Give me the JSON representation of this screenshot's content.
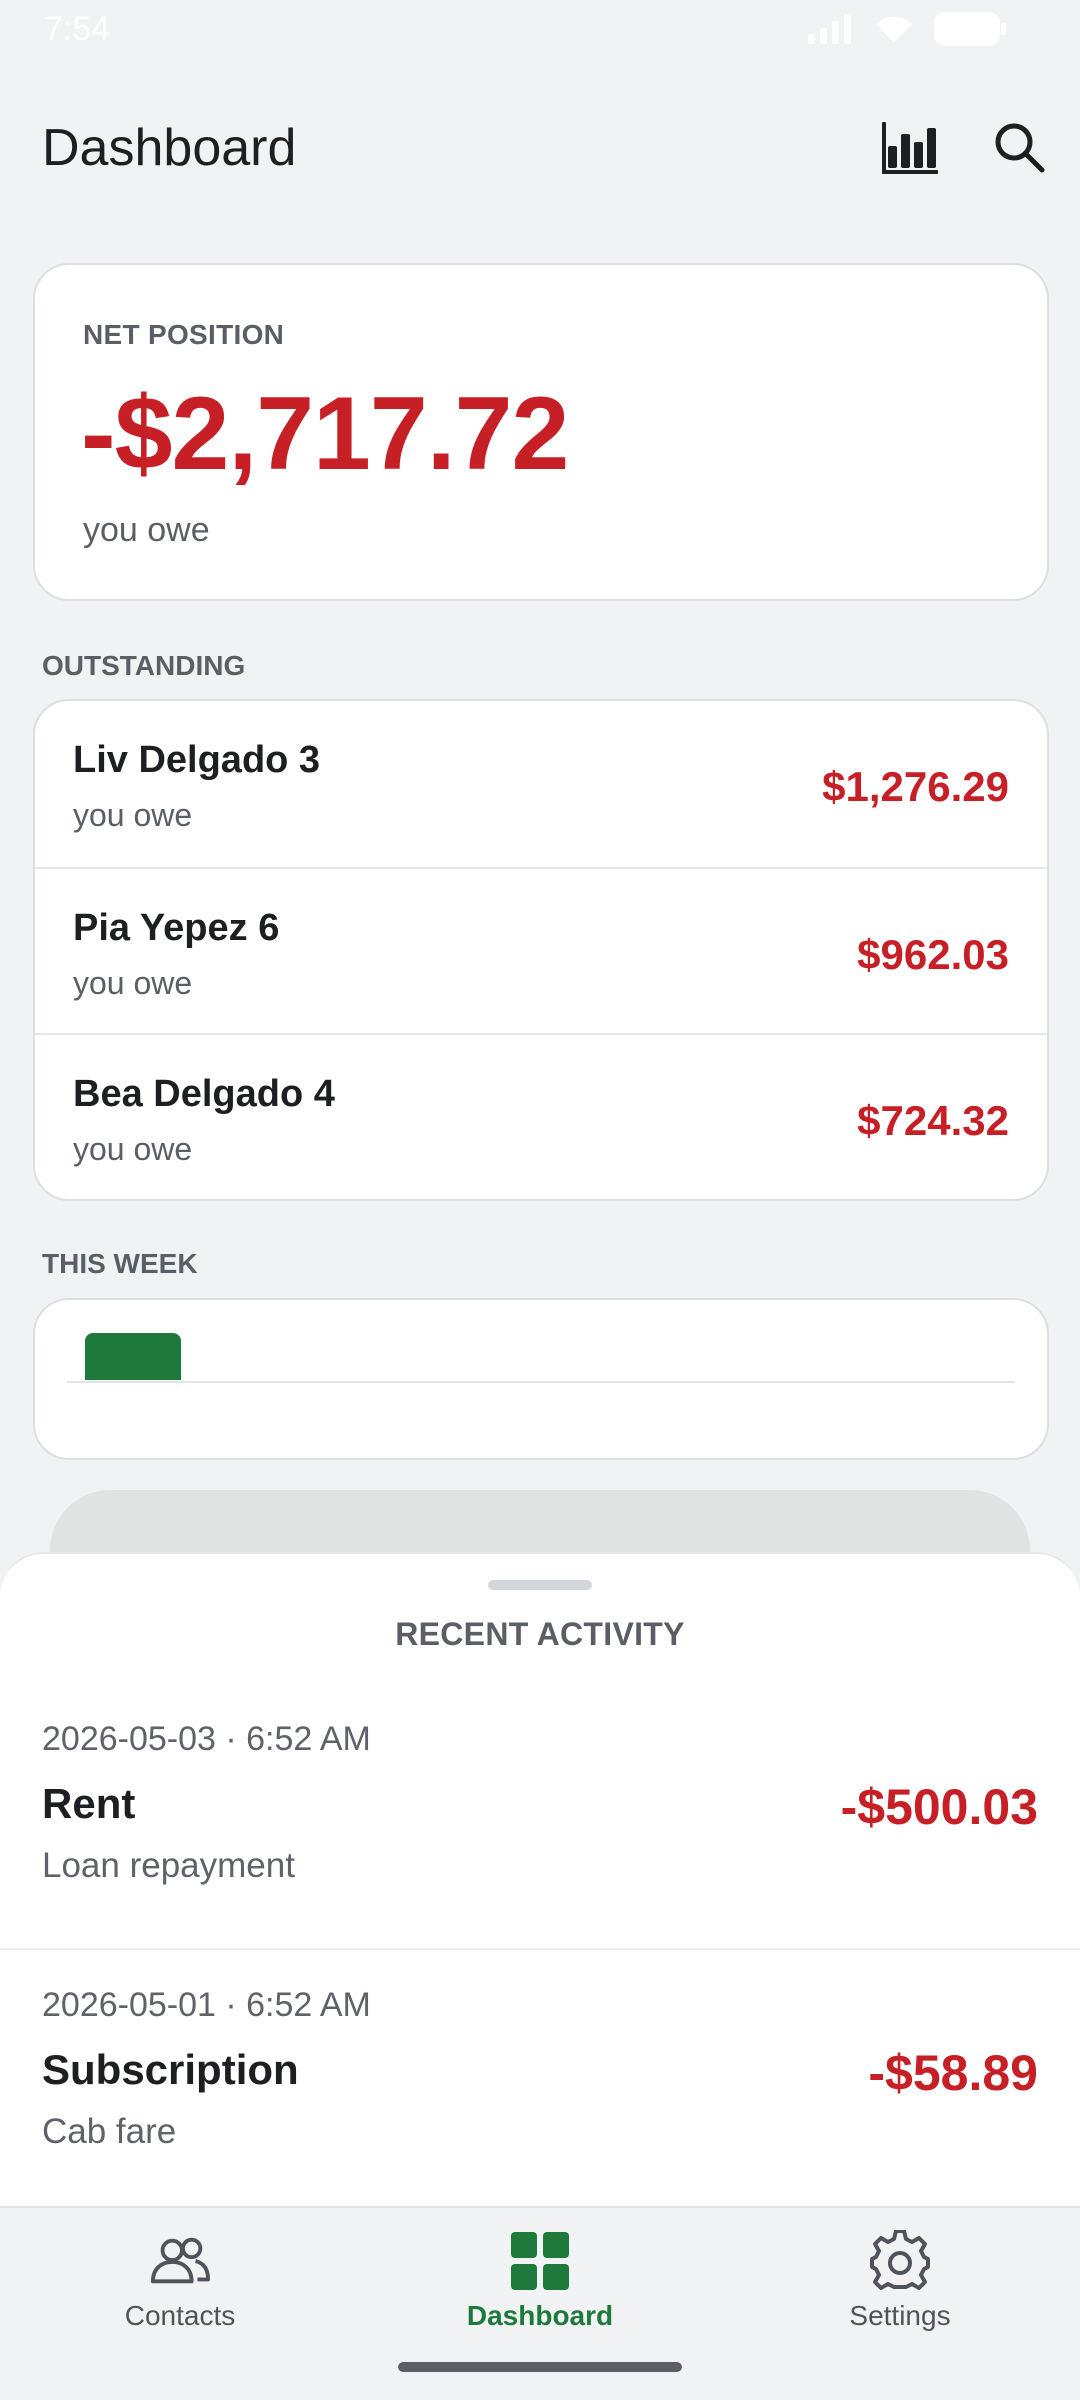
{
  "status_bar": {
    "time": "7:54"
  },
  "header": {
    "title": "Dashboard",
    "chart_icon": "bar-chart-icon",
    "search_icon": "search-icon"
  },
  "net_position": {
    "label": "NET POSITION",
    "amount": "-$2,717.72",
    "sub": "you owe"
  },
  "outstanding": {
    "label": "OUTSTANDING",
    "items": [
      {
        "name": "Liv Delgado 3",
        "sub": "you owe",
        "amount": "$1,276.29"
      },
      {
        "name": "Pia Yepez 6",
        "sub": "you owe",
        "amount": "$962.03"
      },
      {
        "name": "Bea Delgado 4",
        "sub": "you owe",
        "amount": "$724.32"
      }
    ]
  },
  "this_week": {
    "label": "THIS WEEK"
  },
  "recent_activity": {
    "title": "RECENT ACTIVITY",
    "items": [
      {
        "date": "2026-05-03 · 6:52 AM",
        "title": "Rent",
        "note": "Loan repayment",
        "amount": "-$500.03"
      },
      {
        "date": "2026-05-01 · 6:52 AM",
        "title": "Subscription",
        "note": "Cab fare",
        "amount": "-$58.89"
      }
    ]
  },
  "nav": {
    "items": [
      {
        "label": "Contacts",
        "icon": "contacts-icon",
        "active": false
      },
      {
        "label": "Dashboard",
        "icon": "dashboard-icon",
        "active": true
      },
      {
        "label": "Settings",
        "icon": "settings-icon",
        "active": false
      }
    ]
  },
  "colors": {
    "negative": "#c62026",
    "accent": "#1e7a3a",
    "background": "#f1f2f4"
  }
}
